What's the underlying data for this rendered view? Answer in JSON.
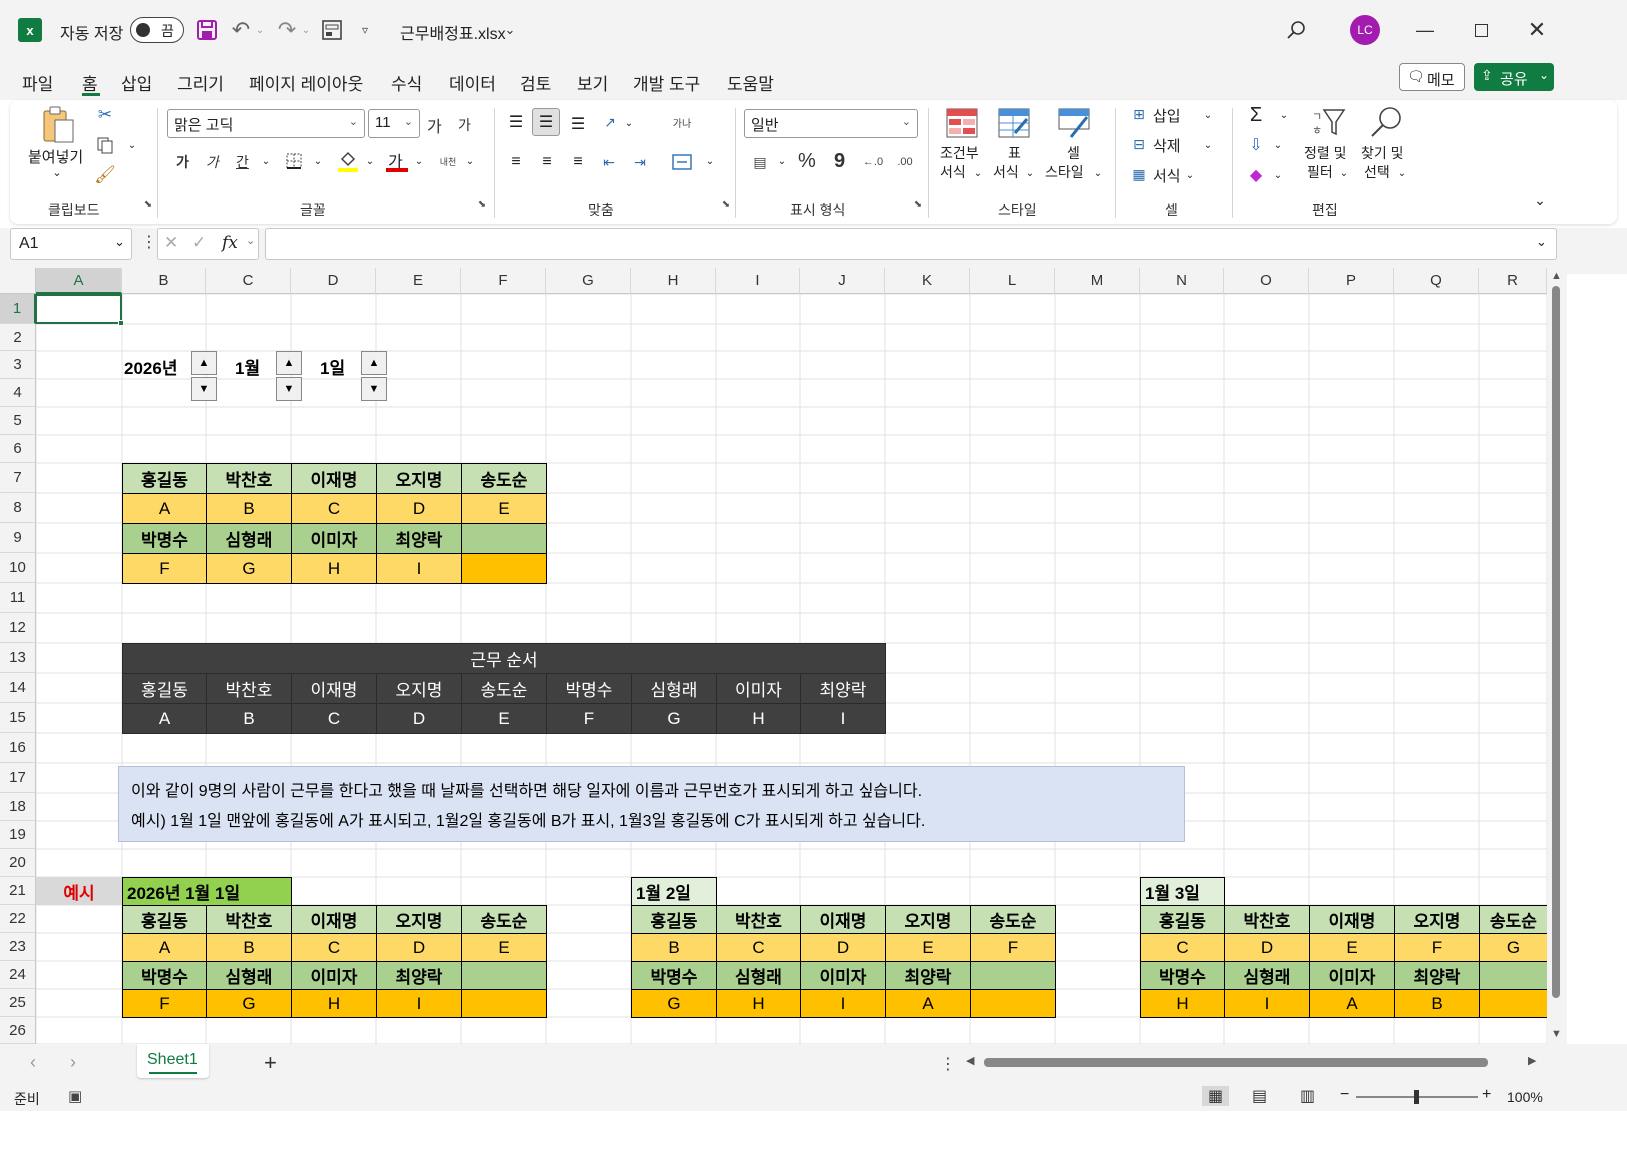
{
  "titlebar": {
    "autosave_label": "자동 저장",
    "autosave_state": "끔",
    "filename": "근무배정표.xlsx",
    "avatar_initials": "LC"
  },
  "menu": {
    "items": [
      "파일",
      "홈",
      "삽입",
      "그리기",
      "페이지 레이아웃",
      "수식",
      "데이터",
      "검토",
      "보기",
      "개발 도구",
      "도움말"
    ],
    "active": "홈",
    "memo_label": "메모",
    "share_label": "공유"
  },
  "ribbon": {
    "clipboard": {
      "paste_label": "붙여넣기",
      "group": "클립보드"
    },
    "font": {
      "name": "맑은 고딕",
      "size": "11",
      "group": "글꼴",
      "bold": "가",
      "italic": "가",
      "underline": "간",
      "font_color_glyph": "가",
      "grow_glyph": "가",
      "shrink_glyph": "가"
    },
    "alignment": {
      "group": "맞춤"
    },
    "number": {
      "format": "일반",
      "group": "표시 형식",
      "percent": "%",
      "comma": "9"
    },
    "styles": {
      "conditional": "조건부\n서식",
      "conditional_l1": "조건부",
      "conditional_l2": "서식",
      "table_l1": "표",
      "table_l2": "서식",
      "cell_l1": "셀",
      "cell_l2": "스타일",
      "group": "스타일"
    },
    "cells": {
      "insert": "삽입",
      "delete": "삭제",
      "format": "서식",
      "group": "셀"
    },
    "editing": {
      "sort_l1": "정렬 및",
      "sort_l2": "필터",
      "find_l1": "찾기 및",
      "find_l2": "선택",
      "group": "편집"
    }
  },
  "formula_bar": {
    "name_box": "A1",
    "fx": "fx",
    "formula": ""
  },
  "columns": [
    "A",
    "B",
    "C",
    "D",
    "E",
    "F",
    "G",
    "H",
    "I",
    "J",
    "K",
    "L",
    "M",
    "N",
    "O",
    "P",
    "Q",
    "R"
  ],
  "rows": [
    "1",
    "2",
    "3",
    "4",
    "5",
    "6",
    "7",
    "8",
    "9",
    "10",
    "11",
    "12",
    "13",
    "14",
    "15",
    "16",
    "17",
    "18",
    "19",
    "20",
    "21",
    "22",
    "23",
    "24",
    "25",
    "26"
  ],
  "date_controls": {
    "year": "2026년",
    "month": "1월",
    "day": "1일"
  },
  "main_table": {
    "names_row1": [
      "홍길동",
      "박찬호",
      "이재명",
      "오지명",
      "송도순"
    ],
    "codes_row1": [
      "A",
      "B",
      "C",
      "D",
      "E"
    ],
    "names_row2": [
      "박명수",
      "심형래",
      "이미자",
      "최양락",
      ""
    ],
    "codes_row2": [
      "F",
      "G",
      "H",
      "I",
      ""
    ]
  },
  "order_table": {
    "title": "근무 순서",
    "names": [
      "홍길동",
      "박찬호",
      "이재명",
      "오지명",
      "송도순",
      "박명수",
      "심형래",
      "이미자",
      "최양락"
    ],
    "codes": [
      "A",
      "B",
      "C",
      "D",
      "E",
      "F",
      "G",
      "H",
      "I"
    ]
  },
  "note": {
    "line1": "이와 같이 9명의 사람이 근무를 한다고 했을 때 날짜를 선택하면 해당 일자에 이름과 근무번호가 표시되게 하고 싶습니다.",
    "line2": "예시) 1월 1일 맨앞에 홍길동에 A가 표시되고, 1월2일  홍길동에 B가 표시, 1월3일 홍길동에 C가 표시되게 하고 싶습니다."
  },
  "example": {
    "label": "예시",
    "blocks": [
      {
        "title": "2026년 1월 1일",
        "names1": [
          "홍길동",
          "박찬호",
          "이재명",
          "오지명",
          "송도순"
        ],
        "codes1": [
          "A",
          "B",
          "C",
          "D",
          "E"
        ],
        "names2": [
          "박명수",
          "심형래",
          "이미자",
          "최양락",
          ""
        ],
        "codes2": [
          "F",
          "G",
          "H",
          "I",
          ""
        ]
      },
      {
        "title": "1월 2일",
        "names1": [
          "홍길동",
          "박찬호",
          "이재명",
          "오지명",
          "송도순"
        ],
        "codes1": [
          "B",
          "C",
          "D",
          "E",
          "F"
        ],
        "names2": [
          "박명수",
          "심형래",
          "이미자",
          "최양락",
          ""
        ],
        "codes2": [
          "G",
          "H",
          "I",
          "A",
          ""
        ]
      },
      {
        "title": "1월 3일",
        "names1": [
          "홍길동",
          "박찬호",
          "이재명",
          "오지명",
          "송도순"
        ],
        "codes1": [
          "C",
          "D",
          "E",
          "F",
          "G"
        ],
        "names2": [
          "박명수",
          "심형래",
          "이미자",
          "최양락",
          ""
        ],
        "codes2": [
          "H",
          "I",
          "A",
          "B",
          ""
        ]
      }
    ]
  },
  "sheet_tabs": {
    "active": "Sheet1",
    "add": "+"
  },
  "status": {
    "ready": "준비",
    "zoom": "100%"
  },
  "colors": {
    "accent_green": "#107c41",
    "avatar": "#a21caf",
    "selection": "#217346"
  }
}
